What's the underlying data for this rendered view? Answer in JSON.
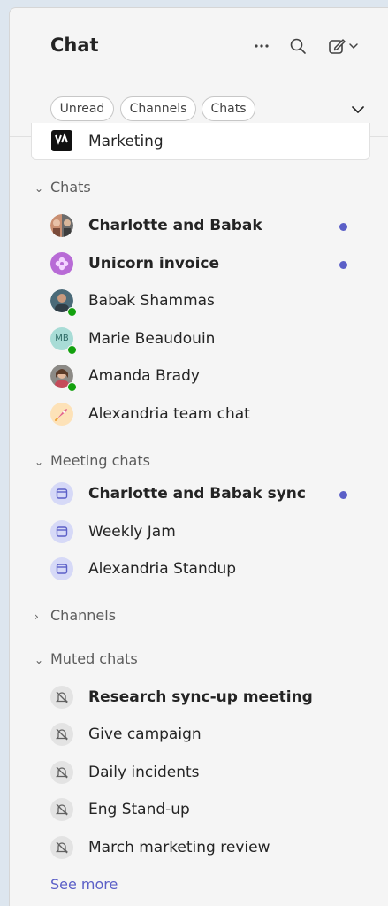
{
  "header": {
    "title": "Chat",
    "more_icon": "more-horizontal-icon",
    "search_icon": "search-icon",
    "compose_icon": "compose-icon"
  },
  "filters": [
    "Unread",
    "Channels",
    "Chats"
  ],
  "pinned": {
    "label": "Marketing"
  },
  "sections": {
    "chats": "Chats",
    "meeting_chats": "Meeting chats",
    "channels": "Channels",
    "muted_chats": "Muted chats"
  },
  "chats": [
    {
      "name": "Charlotte and Babak",
      "unread": true
    },
    {
      "name": "Unicorn invoice",
      "unread": true
    },
    {
      "name": "Babak Shammas",
      "unread": false
    },
    {
      "name": "Marie Beaudouin",
      "initials": "MB",
      "unread": false
    },
    {
      "name": "Amanda Brady",
      "unread": false
    },
    {
      "name": "Alexandria team chat",
      "unread": false
    }
  ],
  "meeting_chats": [
    {
      "name": "Charlotte and Babak sync",
      "unread": true
    },
    {
      "name": "Weekly Jam",
      "unread": false
    },
    {
      "name": "Alexandria Standup",
      "unread": false
    }
  ],
  "muted_chats": [
    {
      "name": "Research sync-up meeting",
      "unread": true
    },
    {
      "name": "Give campaign",
      "unread": false
    },
    {
      "name": "Daily incidents",
      "unread": false
    },
    {
      "name": "Eng Stand-up",
      "unread": false
    },
    {
      "name": "March marketing review",
      "unread": false
    }
  ],
  "see_more": "See more",
  "colors": {
    "accent": "#5b5fc7",
    "presence": "#13a10e"
  }
}
